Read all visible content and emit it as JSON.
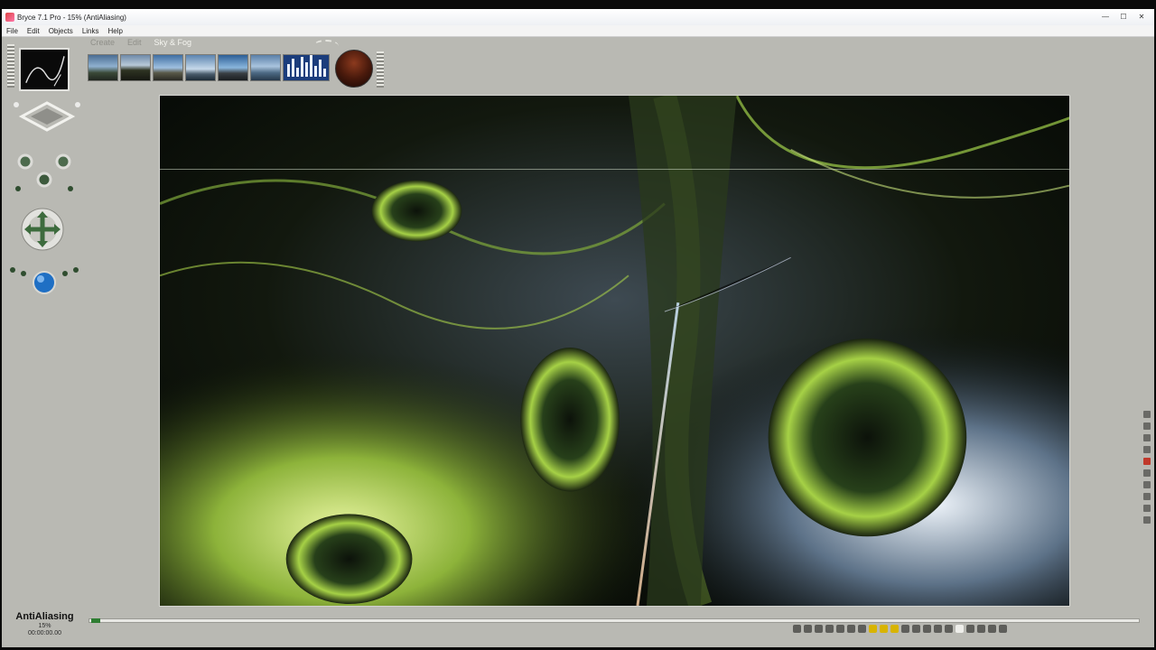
{
  "window": {
    "title": "Bryce 7.1 Pro - 15% (AntiAliasing)",
    "minimize": "—",
    "maximize": "☐",
    "close": "✕"
  },
  "menu": [
    "File",
    "Edit",
    "Objects",
    "Links",
    "Help"
  ],
  "toolbar": {
    "mode_create": "Create",
    "mode_edit": "Edit",
    "mode_sky": "Sky & Fog",
    "preset_count": 7
  },
  "left_panel": {
    "nano_preview": "nano-preview",
    "view_control": "view-control-icon",
    "camera_controls": "camera-trackball-icon"
  },
  "status": {
    "mode": "AntiAliasing",
    "percent": "15%",
    "time": "00:00:00.00"
  },
  "render": {
    "progress_fraction": 0.15
  },
  "colors": {
    "panel": "#b9b9b3",
    "accent_green": "#9bc23c",
    "title_bar": "#eef0f4"
  }
}
